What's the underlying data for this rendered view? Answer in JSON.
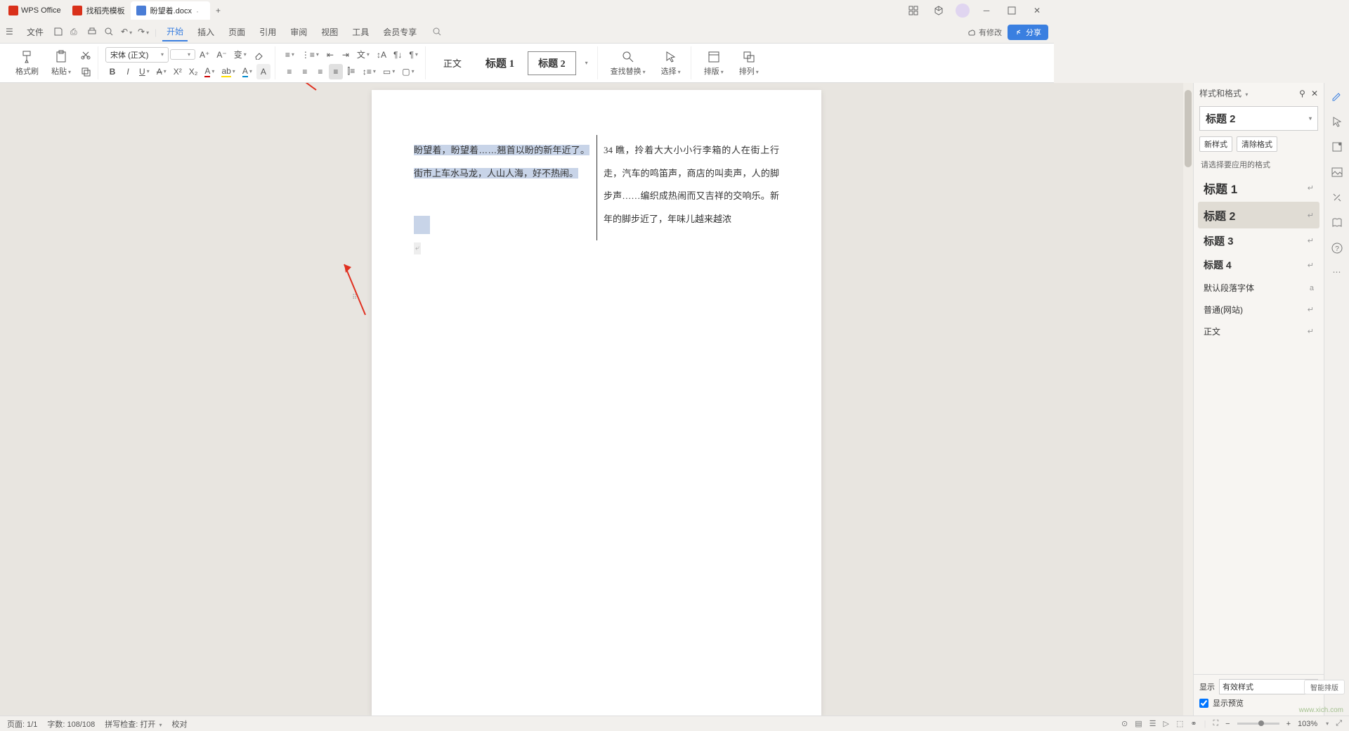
{
  "app": {
    "name": "WPS Office"
  },
  "tabs": [
    {
      "title": "找稻壳模板",
      "icon": "red",
      "active": false
    },
    {
      "title": "盼望着.docx",
      "icon": "blue",
      "active": true
    }
  ],
  "titlebar_icons": [
    "grid-icon",
    "cube-icon",
    "avatar",
    "minimize",
    "maximize",
    "close"
  ],
  "menu": {
    "file": "文件",
    "items": [
      "开始",
      "插入",
      "页面",
      "引用",
      "审阅",
      "视图",
      "工具",
      "会员专享"
    ],
    "active": "开始",
    "has_changes": "有修改",
    "share": "分享"
  },
  "ribbon": {
    "format_painter": "格式刷",
    "paste": "粘贴",
    "font_name": "宋体 (正文)",
    "font_size": "",
    "style_gallery": [
      "正文",
      "标题 1",
      "标题 2"
    ],
    "style_selected": "标题 2",
    "find_replace": "查找替换",
    "select": "选择",
    "layout": "排版",
    "arrange": "排列"
  },
  "document": {
    "col1_text": "盼望着，盼望着……翘首以盼的新年近了。街市上车水马龙，人山人海，好不热闹。",
    "col2_text": "34 瞧，拎着大大小小行李箱的人在街上行走，汽车的鸣笛声，商店的叫卖声，人的脚步声……编织成热闹而又吉祥的交响乐。新年的脚步近了，年味儿越来越浓"
  },
  "styles_panel": {
    "title": "样式和格式",
    "current": "标题 2",
    "new_style": "新样式",
    "clear_format": "清除格式",
    "hint": "请选择要应用的格式",
    "list": [
      {
        "name": "标题 1",
        "cls": "h1s"
      },
      {
        "name": "标题 2",
        "cls": "h2s",
        "active": true
      },
      {
        "name": "标题 3",
        "cls": "h3s"
      },
      {
        "name": "标题 4",
        "cls": "h4s"
      },
      {
        "name": "默认段落字体",
        "cls": ""
      },
      {
        "name": "普通(网站)",
        "cls": ""
      },
      {
        "name": "正文",
        "cls": ""
      }
    ],
    "show_label": "显示",
    "show_value": "有效样式",
    "preview_label": "显示预览",
    "smart": "智能排版"
  },
  "statusbar": {
    "page": "页面: 1/1",
    "words": "字数: 108/108",
    "spell": "拼写检查: 打开",
    "proof": "校对",
    "zoom": "103%"
  },
  "watermark": "www.xich.com"
}
